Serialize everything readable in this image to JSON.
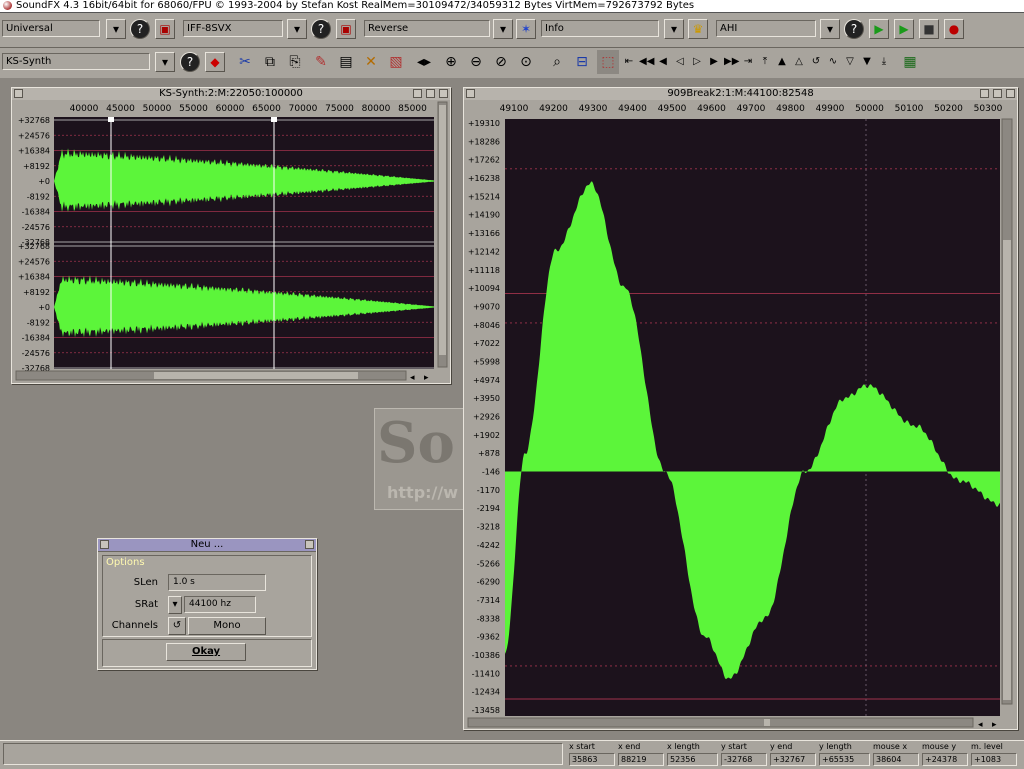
{
  "app": {
    "title": "SoundFX  4.3 16bit/64bit for 68060/FPU © 1993-2004 by Stefan Kost   RealMem=30109472/34059312 Bytes  VirtMem=792673792 Bytes"
  },
  "toolbar1": {
    "universal": "Universal",
    "loader": "IFF-8SVX",
    "operator": "Reverse",
    "rexx": "Info",
    "player": "AHI"
  },
  "toolbar2": {
    "generator": "KS-Synth"
  },
  "wave_left": {
    "title": "KS-Synth:2:M:22050:100000",
    "x_ticks": [
      "40000",
      "45000",
      "50000",
      "55000",
      "60000",
      "65000",
      "70000",
      "75000",
      "80000",
      "85000"
    ],
    "y_ticks": [
      "+32768",
      "+24576",
      "+16384",
      "+8192",
      "+0",
      "-8192",
      "-16384",
      "-24576",
      "-32768",
      "+32768",
      "+24576",
      "+16384",
      "+8192",
      "+0",
      "-8192",
      "-16384",
      "-24576",
      "-32768"
    ]
  },
  "wave_right": {
    "title": "909Break2:1:M:44100:82548",
    "x_ticks": [
      "49100",
      "49200",
      "49300",
      "49400",
      "49500",
      "49600",
      "49700",
      "49800",
      "49900",
      "50000",
      "50100",
      "50200",
      "50300"
    ],
    "y_ticks": [
      "+19310",
      "+18286",
      "+17262",
      "+16238",
      "+15214",
      "+14190",
      "+13166",
      "+12142",
      "+11118",
      "+10094",
      "+9070",
      "+8046",
      "+7022",
      "+5998",
      "+4974",
      "+3950",
      "+2926",
      "+1902",
      "+878",
      "-146",
      "-1170",
      "-2194",
      "-3218",
      "-4242",
      "-5266",
      "-6290",
      "-7314",
      "-8338",
      "-9362",
      "-10386",
      "-11410",
      "-12434",
      "-13458"
    ]
  },
  "dialog": {
    "title": "Neu ...",
    "section": "Options",
    "slen_label": "SLen",
    "slen_value": "1.0 s",
    "srat_label": "SRat",
    "srat_value": "44100 hz",
    "channels_label": "Channels",
    "channels_value": "Mono",
    "ok_label": "Okay"
  },
  "status": {
    "labels": [
      "x start",
      "x end",
      "x length",
      "y start",
      "y end",
      "y length",
      "mouse x",
      "mouse y",
      "m. level"
    ],
    "values": [
      "35863",
      "88219",
      "52356",
      "-32768",
      "+32767",
      "+65535",
      "38604",
      "+24378",
      "+1083"
    ]
  },
  "colors": {
    "wave": "#5cf53a",
    "bg": "#1c121c",
    "grid": "#a0324b",
    "panel": "#a8a49d"
  }
}
